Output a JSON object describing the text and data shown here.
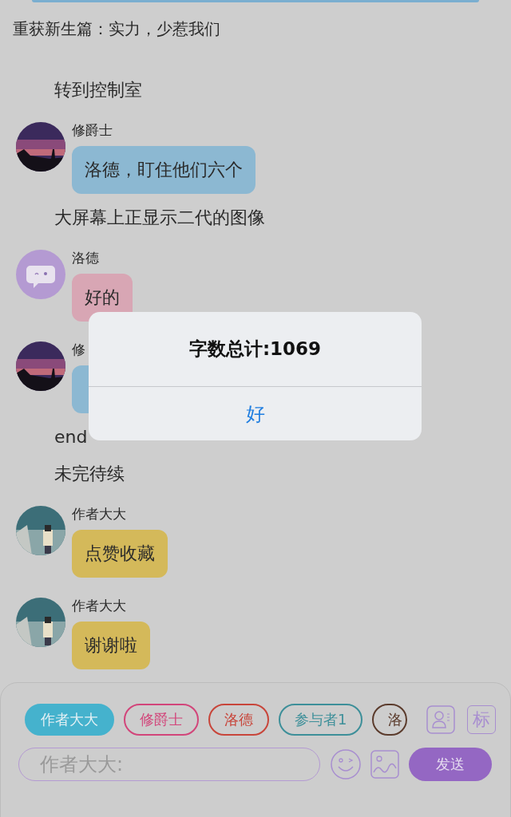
{
  "header": {
    "title": "重获新生篇：实力，少惹我们"
  },
  "chat": [
    {
      "kind": "narration",
      "text": "转到控制室"
    },
    {
      "kind": "message",
      "sender": "修爵士",
      "color": "#8cb8d2",
      "text": "洛德，盯住他们六个"
    },
    {
      "kind": "narration",
      "text": "大屏幕上正显示二代的图像"
    },
    {
      "kind": "message",
      "sender": "洛德",
      "avatar": {
        "kind": "icon"
      },
      "color": "#d8a6b4",
      "text": "好的"
    },
    {
      "kind": "message",
      "sender": "修",
      "color": "#8cb8d2"
    },
    {
      "kind": "narration",
      "text": "end"
    },
    {
      "kind": "narration",
      "text": "未完待续"
    },
    {
      "kind": "message",
      "sender": "作者大大",
      "color": "#d4b95a",
      "text": "点赞收藏"
    },
    {
      "kind": "message",
      "sender": "作者大大",
      "color": "#d4b95a",
      "text": "谢谢啦"
    }
  ],
  "composer": {
    "roles": [
      {
        "label": "作者大大",
        "selected": true,
        "color": "#45b2cd"
      },
      {
        "label": "修爵士",
        "selected": false,
        "color": "#d2457a"
      },
      {
        "label": "洛德",
        "selected": false,
        "color": "#c8453a"
      },
      {
        "label": "参与者1",
        "selected": false,
        "color": "#3d8f99"
      },
      {
        "label": "洛",
        "selected": false,
        "color": "#5b3b2c"
      }
    ],
    "mark_button": "标",
    "input": {
      "placeholder": "作者大大:"
    },
    "send": "发送"
  },
  "dialog": {
    "title": "字数总计:1069",
    "button": "好"
  }
}
